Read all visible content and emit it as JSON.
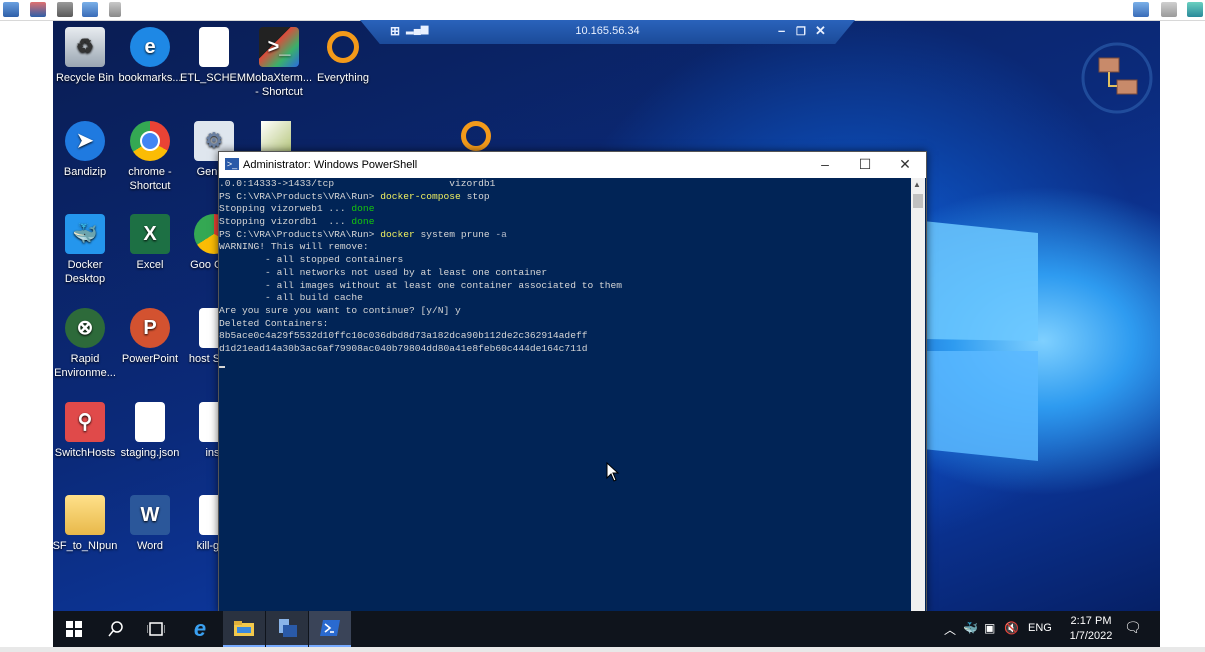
{
  "rdp_bar": {
    "address": "10.165.56.34",
    "pin": "pin-icon",
    "signal": "signal-bars-icon"
  },
  "desktop_icons": [
    {
      "label": "Recycle Bin",
      "icon": "recycle-bin-icon"
    },
    {
      "label": "bookmarks...",
      "icon": "internet-explorer-icon"
    },
    {
      "label": "ETL_SCHEM...",
      "icon": "document-icon"
    },
    {
      "label": "MobaXterm... - Shortcut",
      "icon": "mobaxterm-icon"
    },
    {
      "label": "Everything",
      "icon": "magnifier-icon"
    },
    {
      "label": "Bandizip",
      "icon": "bandizip-icon"
    },
    {
      "label": "chrome - Shortcut",
      "icon": "chrome-icon"
    },
    {
      "label": "GenRe",
      "icon": "gear-document-icon"
    },
    {
      "label": "Docker Desktop",
      "icon": "docker-icon"
    },
    {
      "label": "Excel",
      "icon": "excel-icon"
    },
    {
      "label": "Goo Chro",
      "icon": "chrome-icon"
    },
    {
      "label": "Rapid Environme...",
      "icon": "rapid-environment-icon"
    },
    {
      "label": "PowerPoint",
      "icon": "powerpoint-icon"
    },
    {
      "label": "host Short",
      "icon": "document-icon"
    },
    {
      "label": "SwitchHosts",
      "icon": "switchhosts-icon"
    },
    {
      "label": "staging.json",
      "icon": "document-icon"
    },
    {
      "label": "inst",
      "icon": "document-icon"
    },
    {
      "label": "SF_to_NIpun",
      "icon": "folder-icon"
    },
    {
      "label": "Word",
      "icon": "word-icon"
    },
    {
      "label": "kill-gug",
      "icon": "document-icon"
    }
  ],
  "powershell": {
    "title": "Administrator: Windows PowerShell",
    "lines": [
      {
        "segments": [
          {
            "text": ".0.0:14333->1433/tcp                    vizordb1",
            "style": "out"
          }
        ]
      },
      {
        "segments": [
          {
            "text": "PS C:\\VRA\\Products\\VRA\\Run> ",
            "style": "out"
          },
          {
            "text": "docker-compose ",
            "style": "cmd"
          },
          {
            "text": "stop",
            "style": "out"
          }
        ]
      },
      {
        "segments": [
          {
            "text": "Stopping vizorweb1 ... ",
            "style": "out"
          },
          {
            "text": "done",
            "style": "ok"
          }
        ]
      },
      {
        "segments": [
          {
            "text": "Stopping vizordb1  ... ",
            "style": "out"
          },
          {
            "text": "done",
            "style": "ok"
          }
        ]
      },
      {
        "segments": [
          {
            "text": "PS C:\\VRA\\Products\\VRA\\Run> ",
            "style": "out"
          },
          {
            "text": "docker ",
            "style": "cmd"
          },
          {
            "text": "system prune ",
            "style": "out"
          },
          {
            "text": "-a",
            "style": "prm"
          }
        ]
      },
      {
        "segments": [
          {
            "text": "WARNING! This will remove:",
            "style": "out"
          }
        ]
      },
      {
        "segments": [
          {
            "text": "        - all stopped containers",
            "style": "out"
          }
        ]
      },
      {
        "segments": [
          {
            "text": "        - all networks not used by at least one container",
            "style": "out"
          }
        ]
      },
      {
        "segments": [
          {
            "text": "        - all images without at least one container associated to them",
            "style": "out"
          }
        ]
      },
      {
        "segments": [
          {
            "text": "        - all build cache",
            "style": "out"
          }
        ]
      },
      {
        "segments": [
          {
            "text": "Are you sure you want to continue? [y/N] y",
            "style": "out"
          }
        ]
      },
      {
        "segments": [
          {
            "text": "Deleted Containers:",
            "style": "out"
          }
        ]
      },
      {
        "segments": [
          {
            "text": "8b5ace0c4a29f5532d10ffc10c036dbd8d73a182dca90b112de2c362914adeff",
            "style": "out"
          }
        ]
      },
      {
        "segments": [
          {
            "text": "d1d21ead14a30b3ac6af79908ac040b79804dd80a41e8feb60c444de164c711d",
            "style": "out"
          }
        ]
      }
    ]
  },
  "taskbar": {
    "items": [
      {
        "name": "start-button",
        "icon": "windows-logo-icon"
      },
      {
        "name": "search-button",
        "icon": "search-icon"
      },
      {
        "name": "task-view-button",
        "icon": "task-view-icon"
      },
      {
        "name": "taskbar-internet-explorer",
        "icon": "internet-explorer-icon"
      },
      {
        "name": "taskbar-file-explorer",
        "icon": "folder-icon"
      },
      {
        "name": "taskbar-server-manager",
        "icon": "server-manager-icon"
      },
      {
        "name": "taskbar-powershell",
        "icon": "powershell-icon"
      }
    ],
    "language": "ENG",
    "time": "2:17 PM",
    "date": "1/7/2022"
  },
  "colors": {
    "console_bg": "#012456",
    "console_text": "#d6d6d6",
    "command": "#f0f060",
    "done": "#16c60c",
    "taskbar": "#0f141c"
  }
}
